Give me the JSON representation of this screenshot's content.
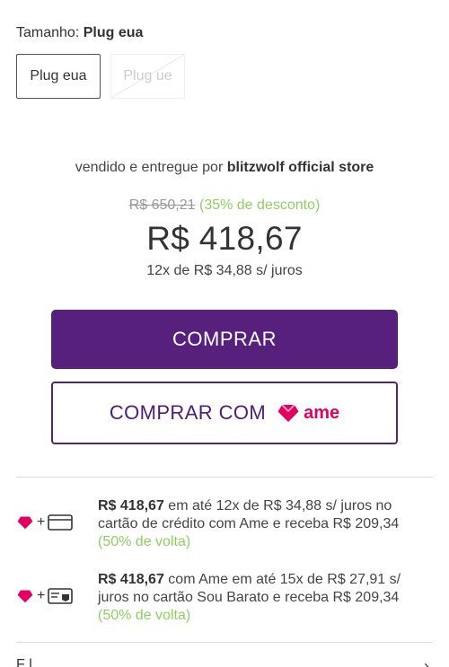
{
  "size": {
    "label": "Tamanho:",
    "selected": "Plug eua",
    "options": [
      {
        "label": "Plug eua",
        "state": "selected"
      },
      {
        "label": "Plug ue",
        "state": "unavailable"
      }
    ]
  },
  "seller": {
    "prefix": "vendido e entregue por",
    "name": "blitzwolf official store"
  },
  "pricing": {
    "old_price": "R$ 650,21",
    "discount": "(35% de desconto)",
    "price": "R$ 418,67",
    "installments": "12x de R$ 34,88 s/ juros"
  },
  "buttons": {
    "buy_label": "COMPRAR",
    "buy_with_label": "COMPRAR COM",
    "ame_brand": "ame"
  },
  "payment_offers": [
    {
      "icons": [
        "ame-heart-icon",
        "credit-card-icon"
      ],
      "plus": "+",
      "amount": "R$ 418,67",
      "text": " em até 12x de R$ 34,88 s/ juros no cartão de crédito  com Ame e receba R$ 209,34 ",
      "cashback": "(50% de volta)"
    },
    {
      "icons": [
        "ame-heart-icon",
        "store-card-icon"
      ],
      "plus": "+",
      "amount": "R$ 418,67",
      "text": " com Ame em até 15x de R$ 27,91 s/ juros no cartão Sou Barato  e receba R$ 209,34 ",
      "cashback": "(50% de volta)"
    }
  ],
  "bottom": {
    "text": "F            l                                    ",
    "arrow": "›"
  },
  "colors": {
    "primary_purple": "#56207c",
    "ame_pink": "#e3005f",
    "discount_green": "#8ecf62"
  }
}
